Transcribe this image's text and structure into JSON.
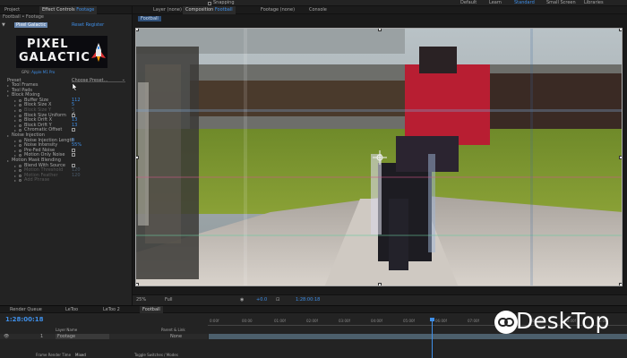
{
  "topbar": {
    "snapping": "Snapping",
    "workspaces": [
      "Default",
      "Learn",
      "Standard",
      "Small Screen",
      "Libraries"
    ],
    "active_workspace": "Standard"
  },
  "left_panel": {
    "tab_project": "Project",
    "tab_effect_prefix": "Effect Controls",
    "tab_effect_layer": "Footage",
    "breadcrumb": "Football • Footage",
    "fx_name": "Pixel Galactic",
    "fx_reset": "Reset",
    "fx_register": "Register",
    "logo_line1": "PIXEL",
    "logo_line2": "GALACTIC",
    "gpu_label": "GPU:",
    "gpu_value": "Apple M1 Pro",
    "preset_label": "Preset",
    "preset_value": "Choose Preset...",
    "params": [
      {
        "label": "Tool Frames",
        "indent": 1,
        "kind": "group"
      },
      {
        "label": "Tool Pads",
        "indent": 1,
        "kind": "group"
      },
      {
        "label": "Block Mixing",
        "indent": 1,
        "kind": "group"
      },
      {
        "label": "Buffer Size",
        "indent": 2,
        "kind": "value",
        "value": "112"
      },
      {
        "label": "Block Size X",
        "indent": 2,
        "kind": "value",
        "value": "5"
      },
      {
        "label": "Block Size Y",
        "indent": 2,
        "kind": "value",
        "value": "5",
        "dim": true
      },
      {
        "label": "Block Size Uniform",
        "indent": 2,
        "kind": "check",
        "checked": true
      },
      {
        "label": "Block Drift X",
        "indent": 2,
        "kind": "value",
        "value": "13"
      },
      {
        "label": "Block Drift Y",
        "indent": 2,
        "kind": "value",
        "value": "13"
      },
      {
        "label": "Chromatic Offset",
        "indent": 2,
        "kind": "check",
        "checked": false
      },
      {
        "label": "Noise Injection",
        "indent": 1,
        "kind": "group"
      },
      {
        "label": "Noise Injection Length",
        "indent": 2,
        "kind": "value",
        "value": "0"
      },
      {
        "label": "Noise Intensity",
        "indent": 2,
        "kind": "value",
        "value": "55%"
      },
      {
        "label": "Pre-Fed Noise",
        "indent": 2,
        "kind": "check",
        "checked": false
      },
      {
        "label": "Motion Only Noise",
        "indent": 2,
        "kind": "check",
        "checked": false
      },
      {
        "label": "Motion Mask Blending",
        "indent": 1,
        "kind": "group"
      },
      {
        "label": "Blend With Source",
        "indent": 2,
        "kind": "check",
        "checked": false
      },
      {
        "label": "Motion Threshold",
        "indent": 2,
        "kind": "value",
        "value": "120",
        "dim": true
      },
      {
        "label": "Motion Feather",
        "indent": 2,
        "kind": "value",
        "value": "120",
        "dim": true
      },
      {
        "label": "Add Phrase",
        "indent": 2,
        "kind": "value",
        "value": "",
        "dim": true
      }
    ]
  },
  "comp": {
    "tab_layer": "Layer (none)",
    "tab_comp_prefix": "Composition",
    "tab_comp_name": "Football",
    "tab_footage": "Footage (none)",
    "tab_console": "Console",
    "sub_tab": "Football",
    "footer": {
      "zoom": "25%",
      "resolution": "Full",
      "plus_value": "+0.0",
      "timecode": "1:28:00:18"
    }
  },
  "bottom": {
    "tabs": [
      "Render Queue",
      "LeToo",
      "LeToo 2",
      "Football"
    ],
    "active_tab": "Football",
    "timecode": "1:28:00:18",
    "ruler": [
      "0:00f",
      "00:00",
      "01:00f",
      "02:00f",
      "03:00f",
      "04:00f",
      "05:00f",
      "06:00f",
      "07:00f",
      "08:00f",
      "09:00f",
      "10:00f",
      "11:00f"
    ],
    "col_layer_name": "Layer Name",
    "col_parent": "Parent & Link",
    "layer_num": "1",
    "layer_name": "Footage",
    "layer_parent": "None",
    "frame_render_time": "Frame Render Time",
    "frame_render_value": "Mixed",
    "toggle_switches": "Toggle Switches / Modes"
  },
  "watermark": {
    "text": "DeskTop"
  },
  "colors": {
    "accent": "#3f8fe8",
    "panel": "#232323",
    "effect_highlight": "#6a88b0"
  }
}
